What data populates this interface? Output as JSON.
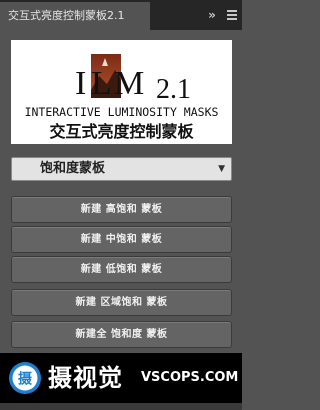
{
  "panel": {
    "tab_title": "交互式亮度控制蒙板2.1",
    "collapse_glyph": "»"
  },
  "logo": {
    "letters": "ILM",
    "version": "2.1",
    "subtitle_en": "INTERACTIVE LUMINOSITY MASKS",
    "subtitle_cn": "交互式亮度控制蒙板"
  },
  "mask_select": {
    "value": "饱和度蒙板",
    "arrow": "▼"
  },
  "buttons": [
    {
      "label": "新建 高饱和 蒙板"
    },
    {
      "label": "新建 中饱和 蒙板"
    },
    {
      "label": "新建 低饱和 蒙板"
    },
    {
      "label": "新建 区域饱和 蒙板"
    },
    {
      "label": "新建全 饱和度 蒙板"
    }
  ],
  "watermark": {
    "seal_char": "摄",
    "text_cn": "摄视觉",
    "text_en": "VSCOPS.COM"
  },
  "colors": {
    "panel_bg": "#535353",
    "tabbar_bg": "#262626",
    "button_bg": "#646464",
    "watermark_bg": "#000000",
    "seal_blue": "#1e7fcf"
  }
}
